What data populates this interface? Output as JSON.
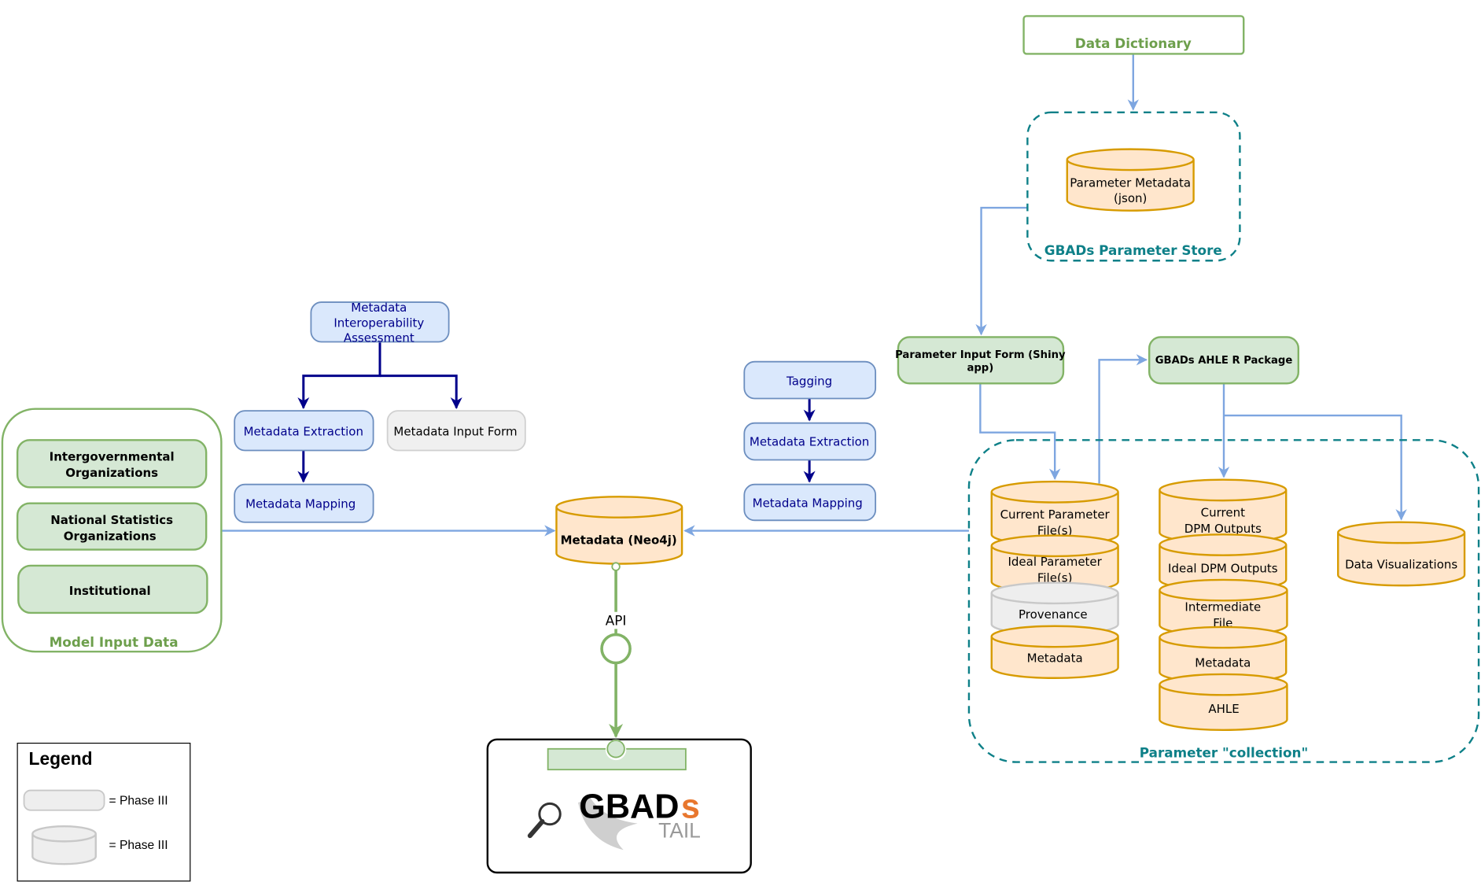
{
  "colors": {
    "green": "#82b366",
    "teal": "#0e8088",
    "orange": "#d79b00",
    "navy": "#00008b",
    "light_blue": "#7ea6e0",
    "logo_orange": "#e8772e"
  },
  "data_dictionary": "Data Dictionary",
  "parameter_store": {
    "label": "GBADs Parameter Store",
    "cylinder": [
      "Parameter Metadata",
      "(json)"
    ]
  },
  "parameter_input_form": [
    "Parameter Input Form (Shiny",
    "app)"
  ],
  "ahle_package": "GBADs AHLE R Package",
  "parameter_collection": {
    "label": "Parameter \"collection\"",
    "stack1": [
      [
        "Current Parameter",
        "File(s)"
      ],
      [
        "Ideal Parameter",
        "File(s)"
      ],
      [
        "Provenance"
      ],
      [
        "Metadata"
      ]
    ],
    "stack2": [
      [
        "Current",
        "DPM Outputs"
      ],
      [
        "Ideal DPM Outputs"
      ],
      [
        "Intermediate",
        "File"
      ],
      [
        "Metadata"
      ],
      [
        "AHLE"
      ]
    ],
    "data_visualizations": "Data Visualizations"
  },
  "metadata_neo4j": "Metadata (Neo4j)",
  "api_label": "API",
  "model_input": {
    "label": "Model Input Data",
    "items": [
      [
        "Intergovernmental",
        "Organizations"
      ],
      [
        "National Statistics",
        "Organizations"
      ],
      [
        "Institutional"
      ]
    ]
  },
  "left_flow": {
    "interop": [
      "Metadata",
      "Interoperability",
      "Assessment"
    ],
    "extraction": "Metadata Extraction",
    "input_form": "Metadata Input Form",
    "mapping": "Metadata Mapping"
  },
  "middle_flow": {
    "tagging": "Tagging",
    "extraction": "Metadata Extraction",
    "mapping": "Metadata Mapping"
  },
  "logo": {
    "main": "GBAD",
    "suffix": "s",
    "sub": "TAIL"
  },
  "legend": {
    "title": "Legend",
    "box_label": "= Phase III",
    "cylinder_label": "= Phase III"
  }
}
